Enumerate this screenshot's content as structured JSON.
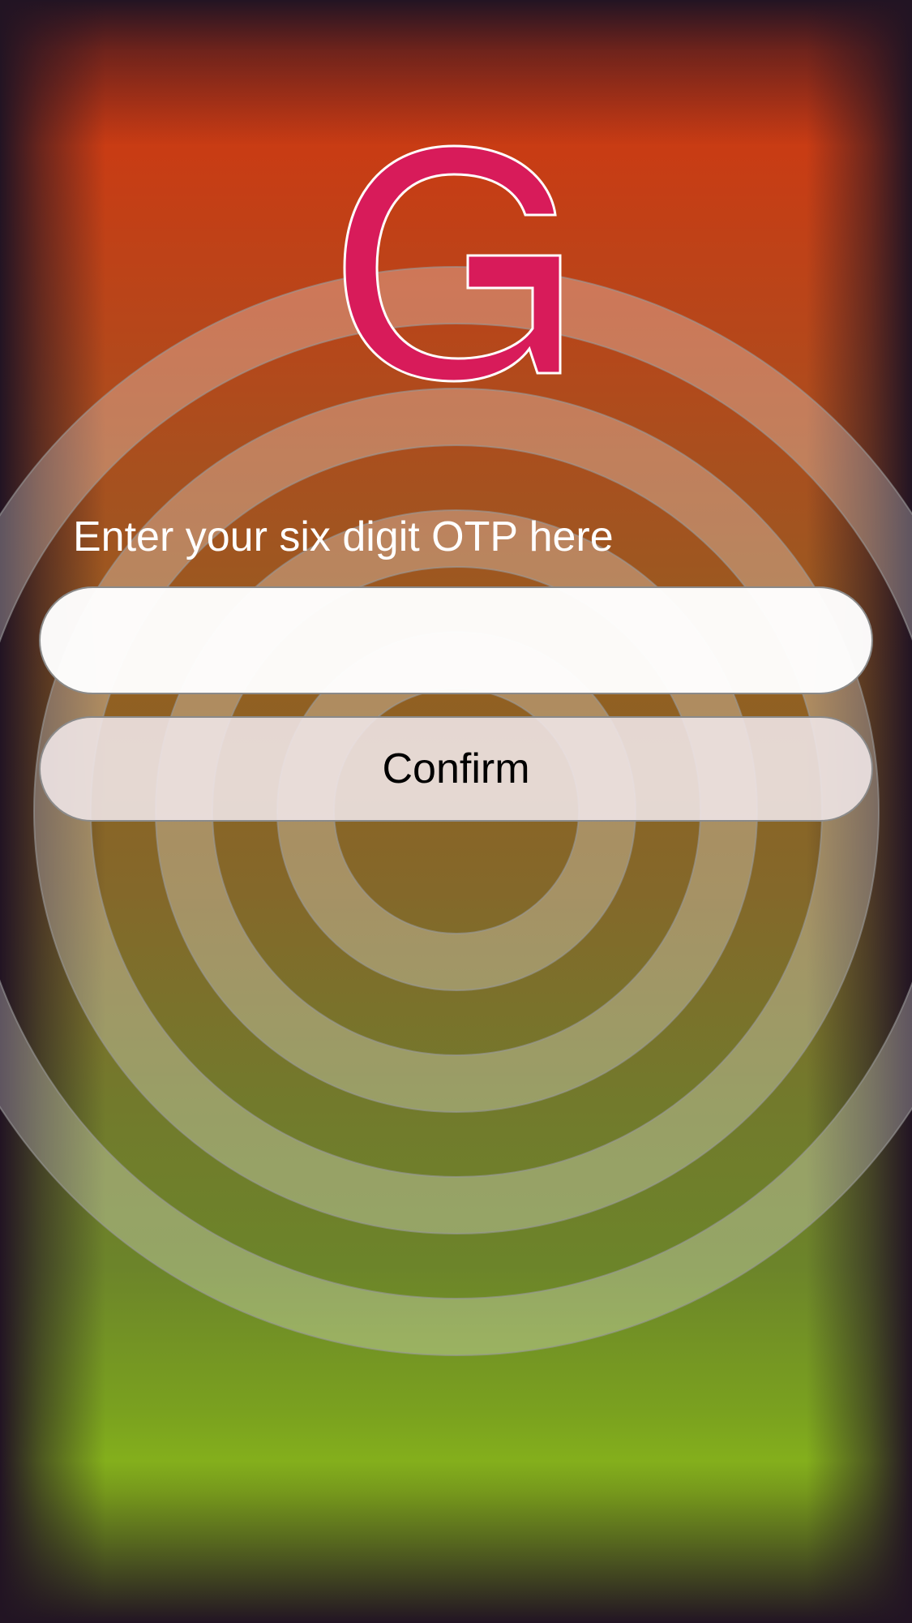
{
  "app": {
    "logo_letter": "G",
    "logo_icon": "g-logo-icon",
    "colors": {
      "background_top": "#cf3412",
      "background_bottom": "#8cbf1a",
      "logo_fill": "#d81b5a",
      "logo_outline": "#ffffff",
      "ring_color": "#ffffff"
    }
  },
  "otp_form": {
    "prompt": "Enter your six digit OTP here",
    "input_value": "",
    "input_placeholder": "",
    "confirm_label": "Confirm"
  }
}
